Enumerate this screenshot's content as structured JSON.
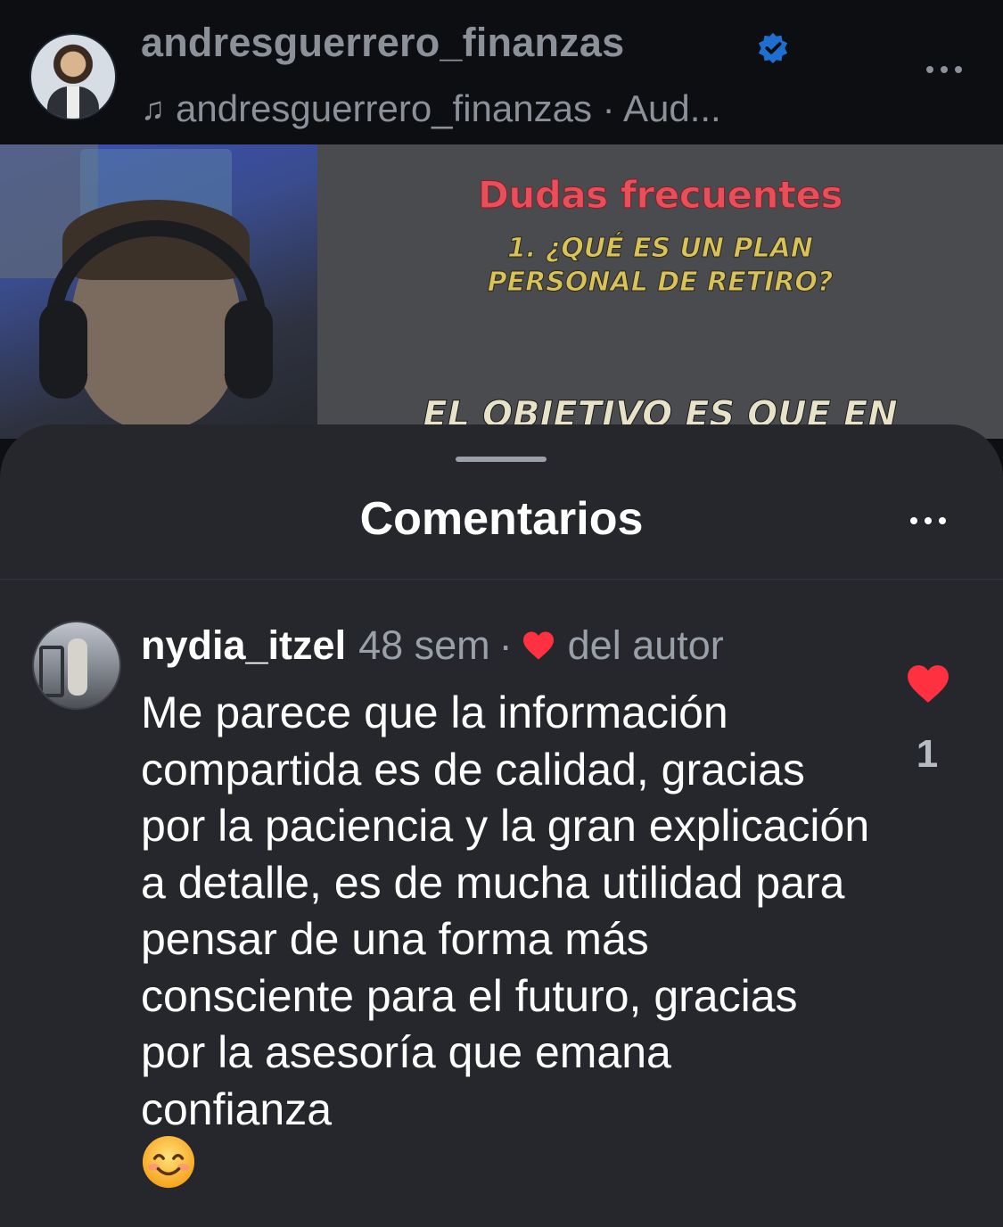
{
  "header": {
    "owner_name": "andresguerrero_finanzas",
    "audio_text": "andresguerrero_finanzas · Aud...",
    "music_icon": "♫"
  },
  "video": {
    "slide_title": "Dudas frecuentes",
    "slide_question_line1": "1. ¿QUÉ ES UN PLAN",
    "slide_question_line2": "PERSONAL DE RETIRO?",
    "slide_bottom": "EL OBJETIVO ES QUE EN"
  },
  "comments_sheet": {
    "title": "Comentarios",
    "comment": {
      "username": "nydia_itzel",
      "time": "48 sem",
      "separator": "·",
      "author_liked_label": "del autor",
      "text": "Me parece que la información compartida es de calidad, gracias por la paciencia y la gran explicación a detalle, es de mucha utilidad para pensar de una forma más consciente para el futuro, gracias por la asesoría que emana confianza",
      "like_count": "1"
    }
  },
  "colors": {
    "like_red": "#ff3040",
    "verified_blue": "#2d8cf0",
    "sheet_bg": "#25272c"
  }
}
